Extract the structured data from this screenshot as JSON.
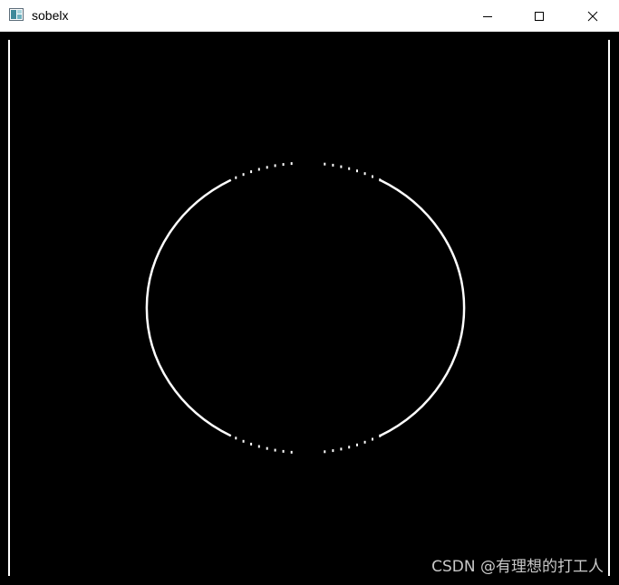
{
  "window": {
    "title": "sobelx"
  },
  "titlebar": {
    "app_icon": "opencv-window-icon",
    "controls": {
      "minimize_icon": "minimize-icon",
      "maximize_icon": "maximize-icon",
      "close_icon": "close-icon"
    }
  },
  "image": {
    "description_colors": {
      "background": "#000000",
      "edges": "#ffffff"
    }
  },
  "watermark": {
    "text": "CSDN @有理想的打工人"
  }
}
